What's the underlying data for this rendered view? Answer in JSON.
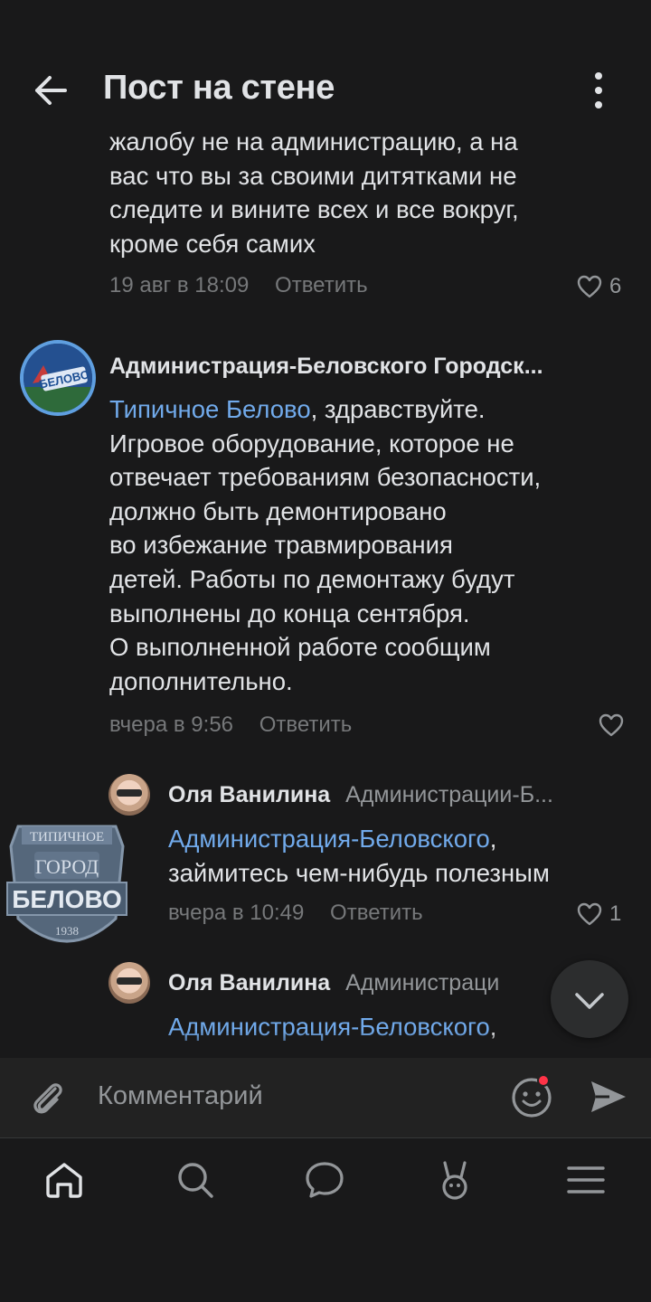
{
  "header": {
    "title": "Пост на стене"
  },
  "comments": [
    {
      "text_lines": [
        "жалобу не на администрацию, а на",
        "вас что вы за своими дитятками не",
        "следите и вините всех и все вокруг,",
        "кроме себя самих"
      ],
      "time": "19 авг в 18:09",
      "reply_label": "Ответить",
      "likes": "6"
    },
    {
      "author": "Администрация-Беловского Городск...",
      "avatar_label": "БЕЛОВО",
      "mention": "Типичное Белово",
      "first_line_rest": ", здравствуйте.",
      "text_lines": [
        "Игровое оборудование, которое не",
        "отвечает требованиям безопасности,",
        "должно быть демонтировано",
        "во избежание травмирования",
        "детей. Работы по демонтажу будут",
        "выполнены до конца сентября.",
        "О выполненной работе сообщим",
        "дополнительно."
      ],
      "time": "вчера в 9:56",
      "reply_label": "Ответить"
    },
    {
      "author": "Оля Ванилина",
      "reply_to": "Администрации-Б...",
      "mention": "Администрация-Беловского",
      "first_line_rest": ",",
      "text_lines": [
        "займитесь чем-нибудь полезным"
      ],
      "time": "вчера в 10:49",
      "reply_label": "Ответить",
      "likes": "1"
    },
    {
      "author": "Оля Ванилина",
      "reply_to": "Администраци",
      "mention": "Администрация-Беловского",
      "first_line_rest": ","
    }
  ],
  "badge": {
    "line1": "ТИПИЧНОЕ",
    "line2": "ГОРОД",
    "line3": "БЕЛОВО",
    "line4": "1938"
  },
  "composer": {
    "placeholder": "Комментарий"
  },
  "colors": {
    "background": "#19191a",
    "link": "#71aaeb",
    "secondary_text": "#76787a",
    "accent_dot": "#ff3347"
  },
  "icons": {
    "back": "arrow-left-icon",
    "more": "more-vertical-icon",
    "like": "heart-icon",
    "attach": "paperclip-icon",
    "emoji": "smile-icon",
    "send": "send-icon",
    "scroll": "chevron-down-icon",
    "tabs": [
      "home-icon",
      "search-icon",
      "messages-icon",
      "clips-icon",
      "menu-icon"
    ]
  }
}
